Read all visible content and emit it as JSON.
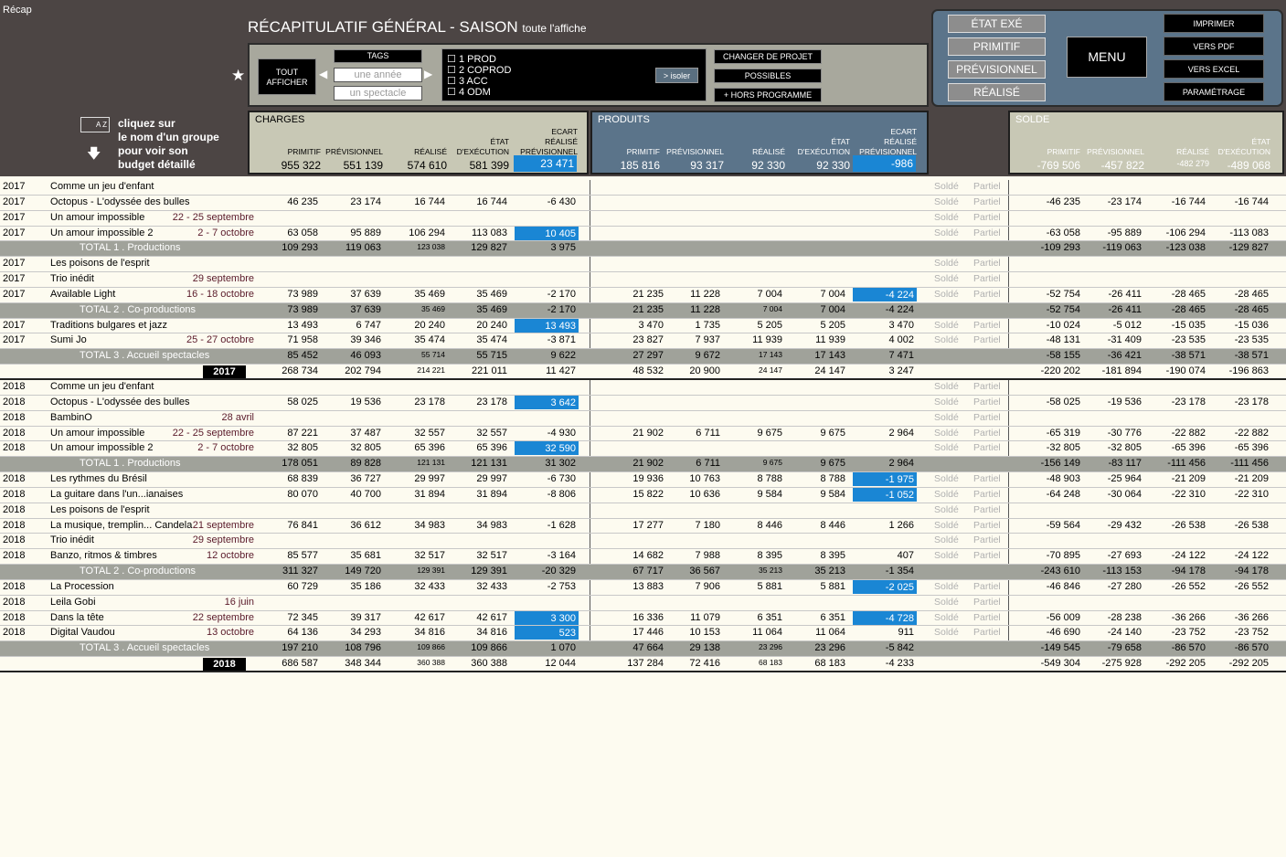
{
  "window_title": "Récap",
  "title": {
    "main": "RÉCAPITULATIF GÉNÉRAL - SAISON",
    "sub": "toute l'affiche"
  },
  "controls": {
    "tout_line1": "TOUT",
    "tout_line2": "AFFICHER",
    "tags_label": "TAGS",
    "year_placeholder": "une année",
    "show_placeholder": "un spectacle",
    "isoler": "> isoler",
    "changer": "CHANGER DE PROJET",
    "possibles": "POSSIBLES",
    "hors": "+ HORS PROGRAMME",
    "cats": [
      "1 PROD",
      "2 COPROD",
      "3 ACC",
      "4 ODM"
    ]
  },
  "right_menu": {
    "etat": [
      "ÉTAT EXÉ",
      "PRIMITIF",
      "PRÉVISIONNEL",
      "RÉALISÉ"
    ],
    "menu": "MENU",
    "actions": [
      "IMPRIMER",
      "VERS PDF",
      "VERS EXCEL",
      "PARAMÉTRAGE"
    ]
  },
  "info": {
    "icon_text": "A Z",
    "lines": [
      "cliquez sur",
      "le nom d'un groupe",
      "pour voir son",
      "budget détaillé"
    ]
  },
  "panels": {
    "charges": {
      "title": "CHARGES",
      "heads": [
        "PRIMITIF",
        "PRÉVISIONNEL",
        "RÉALISÉ",
        "ÉTAT\nD'EXÉCUTION",
        "ECART\nRÉALISÉ\nPRÉVISIONNEL"
      ],
      "totals": [
        "955 322",
        "551 139",
        "574 610",
        "581 399",
        "23 471"
      ]
    },
    "produits": {
      "title": "PRODUITS",
      "heads": [
        "PRIMITIF",
        "PRÉVISIONNEL",
        "RÉALISÉ",
        "ÉTAT\nD'EXÉCUTION",
        "ECART\nRÉALISÉ\nPRÉVISIONNEL"
      ],
      "totals": [
        "185 816",
        "93 317",
        "92 330",
        "92 330",
        "-986"
      ]
    },
    "solde": {
      "title": "SOLDE",
      "heads": [
        "PRIMITIF",
        "PRÉVISIONNEL",
        "RÉALISÉ",
        "ÉTAT\nD'EXÉCUTION"
      ],
      "totals": [
        "-769 506",
        "-457 822",
        "-482 279",
        "-489 068"
      ]
    }
  },
  "rows": [
    {
      "t": "r",
      "y": "2017",
      "n": "Comme un jeu d'enfant",
      "d": "",
      "c": [
        "",
        "",
        "",
        "",
        ""
      ],
      "p": [
        "",
        "",
        "",
        "",
        ""
      ],
      "s": [
        "",
        "",
        "",
        ""
      ]
    },
    {
      "t": "r",
      "y": "2017",
      "n": "Octopus - L'odyssée des bulles",
      "d": "",
      "c": [
        "46 235",
        "23 174",
        "16 744",
        "16 744",
        "-6 430"
      ],
      "p": [
        "",
        "",
        "",
        "",
        ""
      ],
      "s": [
        "-46 235",
        "-23 174",
        "-16 744",
        "-16 744"
      ]
    },
    {
      "t": "r",
      "y": "2017",
      "n": "Un amour impossible",
      "d": "22 - 25 septembre",
      "c": [
        "",
        "",
        "",
        "",
        ""
      ],
      "p": [
        "",
        "",
        "",
        "",
        ""
      ],
      "s": [
        "",
        "",
        "",
        ""
      ]
    },
    {
      "t": "r",
      "y": "2017",
      "n": "Un amour impossible 2",
      "d": "2 - 7 octobre",
      "c": [
        "63 058",
        "95 889",
        "106 294",
        "113 083",
        "10 405"
      ],
      "cb": true,
      "p": [
        "",
        "",
        "",
        "",
        ""
      ],
      "s": [
        "-63 058",
        "-95 889",
        "-106 294",
        "-113 083"
      ]
    },
    {
      "t": "t",
      "label": "TOTAL 1 . Productions",
      "c": [
        "109 293",
        "119 063",
        "123 038",
        "129 827",
        "3 975"
      ],
      "p": [
        "",
        "",
        "",
        "",
        ""
      ],
      "s": [
        "-109 293",
        "-119 063",
        "-123 038",
        "-129 827"
      ]
    },
    {
      "t": "r",
      "y": "2017",
      "n": "Les poisons de l'esprit",
      "d": "",
      "c": [
        "",
        "",
        "",
        "",
        ""
      ],
      "p": [
        "",
        "",
        "",
        "",
        ""
      ],
      "s": [
        "",
        "",
        "",
        ""
      ]
    },
    {
      "t": "r",
      "y": "2017",
      "n": "Trio inédit",
      "d": "29 septembre",
      "c": [
        "",
        "",
        "",
        "",
        ""
      ],
      "p": [
        "",
        "",
        "",
        "",
        ""
      ],
      "s": [
        "",
        "",
        "",
        ""
      ]
    },
    {
      "t": "r",
      "y": "2017",
      "n": "Available Light",
      "d": "16 - 18 octobre",
      "c": [
        "73 989",
        "37 639",
        "35 469",
        "35 469",
        "-2 170"
      ],
      "p": [
        "21 235",
        "11 228",
        "7 004",
        "7 004",
        "-4 224"
      ],
      "pb": true,
      "s": [
        "-52 754",
        "-26 411",
        "-28 465",
        "-28 465"
      ]
    },
    {
      "t": "t",
      "label": "TOTAL 2 . Co-productions",
      "c": [
        "73 989",
        "37 639",
        "35 469",
        "35 469",
        "-2 170"
      ],
      "p": [
        "21 235",
        "11 228",
        "7 004",
        "7 004",
        "-4 224"
      ],
      "s": [
        "-52 754",
        "-26 411",
        "-28 465",
        "-28 465"
      ]
    },
    {
      "t": "r",
      "y": "2017",
      "n": "Traditions bulgares et jazz",
      "d": "",
      "c": [
        "13 493",
        "6 747",
        "20 240",
        "20 240",
        "13 493"
      ],
      "cb": true,
      "p": [
        "3 470",
        "1 735",
        "5 205",
        "5 205",
        "3 470"
      ],
      "s": [
        "-10 024",
        "-5 012",
        "-15 035",
        "-15 036"
      ]
    },
    {
      "t": "r",
      "y": "2017",
      "n": "Sumi Jo",
      "d": "25 - 27 octobre",
      "c": [
        "71 958",
        "39 346",
        "35 474",
        "35 474",
        "-3 871"
      ],
      "p": [
        "23 827",
        "7 937",
        "11 939",
        "11 939",
        "4 002"
      ],
      "s": [
        "-48 131",
        "-31 409",
        "-23 535",
        "-23 535"
      ]
    },
    {
      "t": "t",
      "label": "TOTAL 3 . Accueil spectacles",
      "c": [
        "85 452",
        "46 093",
        "55 714",
        "55 715",
        "9 622"
      ],
      "p": [
        "27 297",
        "9 672",
        "17 143",
        "17 143",
        "7 471"
      ],
      "s": [
        "-58 155",
        "-36 421",
        "-38 571",
        "-38 571"
      ]
    },
    {
      "t": "g",
      "label": "2017",
      "c": [
        "268 734",
        "202 794",
        "214 221",
        "221 011",
        "11 427"
      ],
      "p": [
        "48 532",
        "20 900",
        "24 147",
        "24 147",
        "3 247"
      ],
      "s": [
        "-220 202",
        "-181 894",
        "-190 074",
        "-196 863"
      ]
    },
    {
      "t": "r",
      "y": "2018",
      "n": "Comme un jeu d'enfant",
      "d": "",
      "c": [
        "",
        "",
        "",
        "",
        ""
      ],
      "p": [
        "",
        "",
        "",
        "",
        ""
      ],
      "s": [
        "",
        "",
        "",
        ""
      ]
    },
    {
      "t": "r",
      "y": "2018",
      "n": "Octopus - L'odyssée des bulles",
      "d": "",
      "c": [
        "58 025",
        "19 536",
        "23 178",
        "23 178",
        "3 642"
      ],
      "cb": true,
      "p": [
        "",
        "",
        "",
        "",
        ""
      ],
      "s": [
        "-58 025",
        "-19 536",
        "-23 178",
        "-23 178"
      ]
    },
    {
      "t": "r",
      "y": "2018",
      "n": "BambinO",
      "d": "28 avril",
      "c": [
        "",
        "",
        "",
        "",
        ""
      ],
      "p": [
        "",
        "",
        "",
        "",
        ""
      ],
      "s": [
        "",
        "",
        "",
        ""
      ]
    },
    {
      "t": "r",
      "y": "2018",
      "n": "Un amour impossible",
      "d": "22 - 25 septembre",
      "c": [
        "87 221",
        "37 487",
        "32 557",
        "32 557",
        "-4 930"
      ],
      "p": [
        "21 902",
        "6 711",
        "9 675",
        "9 675",
        "2 964"
      ],
      "s": [
        "-65 319",
        "-30 776",
        "-22 882",
        "-22 882"
      ]
    },
    {
      "t": "r",
      "y": "2018",
      "n": "Un amour impossible 2",
      "d": "2 - 7 octobre",
      "c": [
        "32 805",
        "32 805",
        "65 396",
        "65 396",
        "32 590"
      ],
      "cb": true,
      "p": [
        "",
        "",
        "",
        "",
        ""
      ],
      "s": [
        "-32 805",
        "-32 805",
        "-65 396",
        "-65 396"
      ]
    },
    {
      "t": "t",
      "label": "TOTAL 1 . Productions",
      "c": [
        "178 051",
        "89 828",
        "121 131",
        "121 131",
        "31 302"
      ],
      "p": [
        "21 902",
        "6 711",
        "9 675",
        "9 675",
        "2 964"
      ],
      "s": [
        "-156 149",
        "-83 117",
        "-111 456",
        "-111 456"
      ]
    },
    {
      "t": "r",
      "y": "2018",
      "n": "Les rythmes du Brésil",
      "d": "",
      "c": [
        "68 839",
        "36 727",
        "29 997",
        "29 997",
        "-6 730"
      ],
      "p": [
        "19 936",
        "10 763",
        "8 788",
        "8 788",
        "-1 975"
      ],
      "pb": true,
      "s": [
        "-48 903",
        "-25 964",
        "-21 209",
        "-21 209"
      ]
    },
    {
      "t": "r",
      "y": "2018",
      "n": "La guitare dans l'un...ianaises",
      "d": "",
      "c": [
        "80 070",
        "40 700",
        "31 894",
        "31 894",
        "-8 806"
      ],
      "p": [
        "15 822",
        "10 636",
        "9 584",
        "9 584",
        "-1 052"
      ],
      "pb": true,
      "s": [
        "-64 248",
        "-30 064",
        "-22 310",
        "-22 310"
      ]
    },
    {
      "t": "r",
      "y": "2018",
      "n": "Les poisons de l'esprit",
      "d": "",
      "c": [
        "",
        "",
        "",
        "",
        ""
      ],
      "p": [
        "",
        "",
        "",
        "",
        ""
      ],
      "s": [
        "",
        "",
        "",
        ""
      ]
    },
    {
      "t": "r",
      "y": "2018",
      "n": "La musique, tremplin... Candela",
      "d": "21 septembre",
      "c": [
        "76 841",
        "36 612",
        "34 983",
        "34 983",
        "-1 628"
      ],
      "p": [
        "17 277",
        "7 180",
        "8 446",
        "8 446",
        "1 266"
      ],
      "s": [
        "-59 564",
        "-29 432",
        "-26 538",
        "-26 538"
      ]
    },
    {
      "t": "r",
      "y": "2018",
      "n": "Trio inédit",
      "d": "29 septembre",
      "c": [
        "",
        "",
        "",
        "",
        ""
      ],
      "p": [
        "",
        "",
        "",
        "",
        ""
      ],
      "s": [
        "",
        "",
        "",
        ""
      ]
    },
    {
      "t": "r",
      "y": "2018",
      "n": "Banzo, ritmos & timbres",
      "d": "12 octobre",
      "c": [
        "85 577",
        "35 681",
        "32 517",
        "32 517",
        "-3 164"
      ],
      "p": [
        "14 682",
        "7 988",
        "8 395",
        "8 395",
        "407"
      ],
      "s": [
        "-70 895",
        "-27 693",
        "-24 122",
        "-24 122"
      ]
    },
    {
      "t": "t",
      "label": "TOTAL 2 . Co-productions",
      "c": [
        "311 327",
        "149 720",
        "129 391",
        "129 391",
        "-20 329"
      ],
      "p": [
        "67 717",
        "36 567",
        "35 213",
        "35 213",
        "-1 354"
      ],
      "s": [
        "-243 610",
        "-113 153",
        "-94 178",
        "-94 178"
      ]
    },
    {
      "t": "r",
      "y": "2018",
      "n": "La Procession",
      "d": "",
      "c": [
        "60 729",
        "35 186",
        "32 433",
        "32 433",
        "-2 753"
      ],
      "p": [
        "13 883",
        "7 906",
        "5 881",
        "5 881",
        "-2 025"
      ],
      "pb": true,
      "s": [
        "-46 846",
        "-27 280",
        "-26 552",
        "-26 552"
      ]
    },
    {
      "t": "r",
      "y": "2018",
      "n": "Leila Gobi",
      "d": "16 juin",
      "c": [
        "",
        "",
        "",
        "",
        ""
      ],
      "p": [
        "",
        "",
        "",
        "",
        ""
      ],
      "s": [
        "",
        "",
        "",
        ""
      ]
    },
    {
      "t": "r",
      "y": "2018",
      "n": "Dans la tête",
      "d": "22 septembre",
      "c": [
        "72 345",
        "39 317",
        "42 617",
        "42 617",
        "3 300"
      ],
      "cb": true,
      "p": [
        "16 336",
        "11 079",
        "6 351",
        "6 351",
        "-4 728"
      ],
      "pb": true,
      "s": [
        "-56 009",
        "-28 238",
        "-36 266",
        "-36 266"
      ]
    },
    {
      "t": "r",
      "y": "2018",
      "n": "Digital Vaudou",
      "d": "13 octobre",
      "c": [
        "64 136",
        "34 293",
        "34 816",
        "34 816",
        "523"
      ],
      "cb": true,
      "p": [
        "17 446",
        "10 153",
        "11 064",
        "11 064",
        "911"
      ],
      "s": [
        "-46 690",
        "-24 140",
        "-23 752",
        "-23 752"
      ]
    },
    {
      "t": "t",
      "label": "TOTAL 3 . Accueil spectacles",
      "c": [
        "197 210",
        "108 796",
        "109 866",
        "109 866",
        "1 070"
      ],
      "p": [
        "47 664",
        "29 138",
        "23 296",
        "23 296",
        "-5 842"
      ],
      "s": [
        "-149 545",
        "-79 658",
        "-86 570",
        "-86 570"
      ]
    },
    {
      "t": "g",
      "label": "2018",
      "c": [
        "686 587",
        "348 344",
        "360 388",
        "360 388",
        "12 044"
      ],
      "p": [
        "137 284",
        "72 416",
        "68 183",
        "68 183",
        "-4 233"
      ],
      "s": [
        "-549 304",
        "-275 928",
        "-292 205",
        "-292 205"
      ]
    }
  ],
  "status": {
    "solde": "Soldé",
    "partiel": "Partiel"
  }
}
